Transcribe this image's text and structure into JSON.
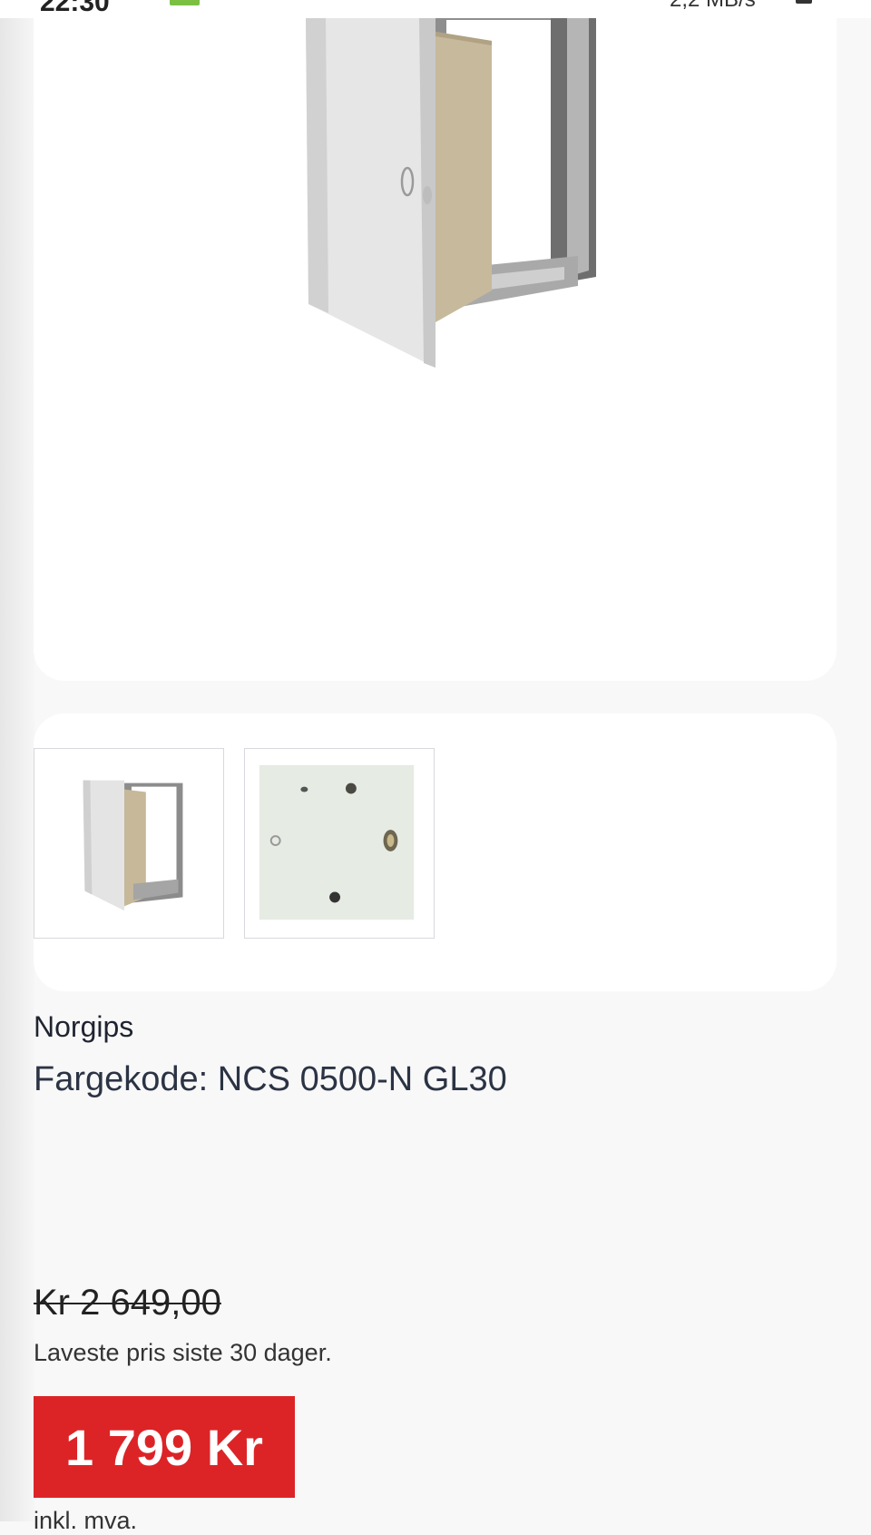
{
  "status_bar": {
    "time": "22:30",
    "network": "2,2 MB/s"
  },
  "product": {
    "main_image_alt": "Inspeksjonsluke",
    "brand": "Norgips",
    "title": "Fargekode: NCS 0500-N GL30",
    "thumbnails": [
      {
        "alt": "Inspeksjonsluke åpen"
      },
      {
        "alt": "Inspeksjonsluke lukket"
      }
    ]
  },
  "pricing": {
    "old_price": "Kr 2 649,00",
    "lowest_note": "Laveste pris siste 30 dager.",
    "price": "1 799 Kr",
    "vat_note": "inkl. mva."
  },
  "colors": {
    "price_badge": "#dc2427",
    "background": "#f8f8f8",
    "card": "#ffffff"
  }
}
